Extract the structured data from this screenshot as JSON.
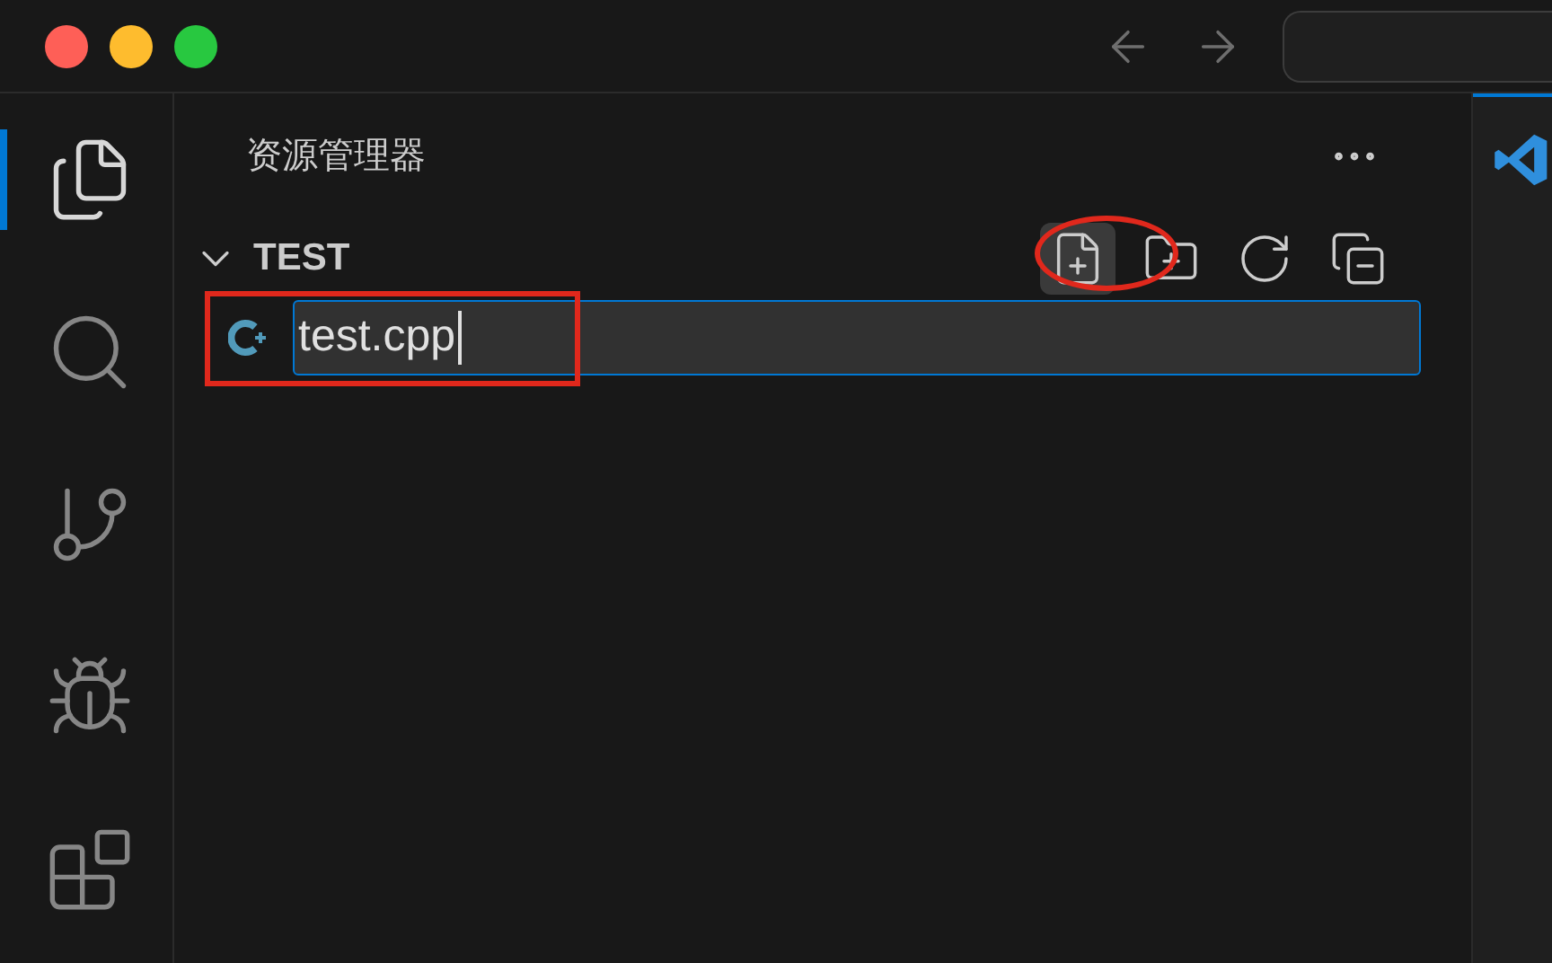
{
  "window": {
    "controls": [
      {
        "color": "#fe5f57"
      },
      {
        "color": "#febc2e"
      },
      {
        "color": "#28c840"
      }
    ]
  },
  "activity_bar": [
    {
      "kind": "explorer",
      "selected": true
    },
    {
      "kind": "search",
      "selected": false
    },
    {
      "kind": "source-control",
      "selected": false
    },
    {
      "kind": "run-debug",
      "selected": false
    },
    {
      "kind": "extensions",
      "selected": false
    }
  ],
  "sidebar": {
    "title": "资源管理器",
    "folder": {
      "name": "TEST",
      "expanded": true
    },
    "actions": [
      {
        "kind": "new-file",
        "hovered": true
      },
      {
        "kind": "new-folder",
        "hovered": false
      },
      {
        "kind": "refresh",
        "hovered": false
      },
      {
        "kind": "collapse",
        "hovered": false
      }
    ],
    "new_file_input": {
      "value": "test.cpp"
    }
  }
}
